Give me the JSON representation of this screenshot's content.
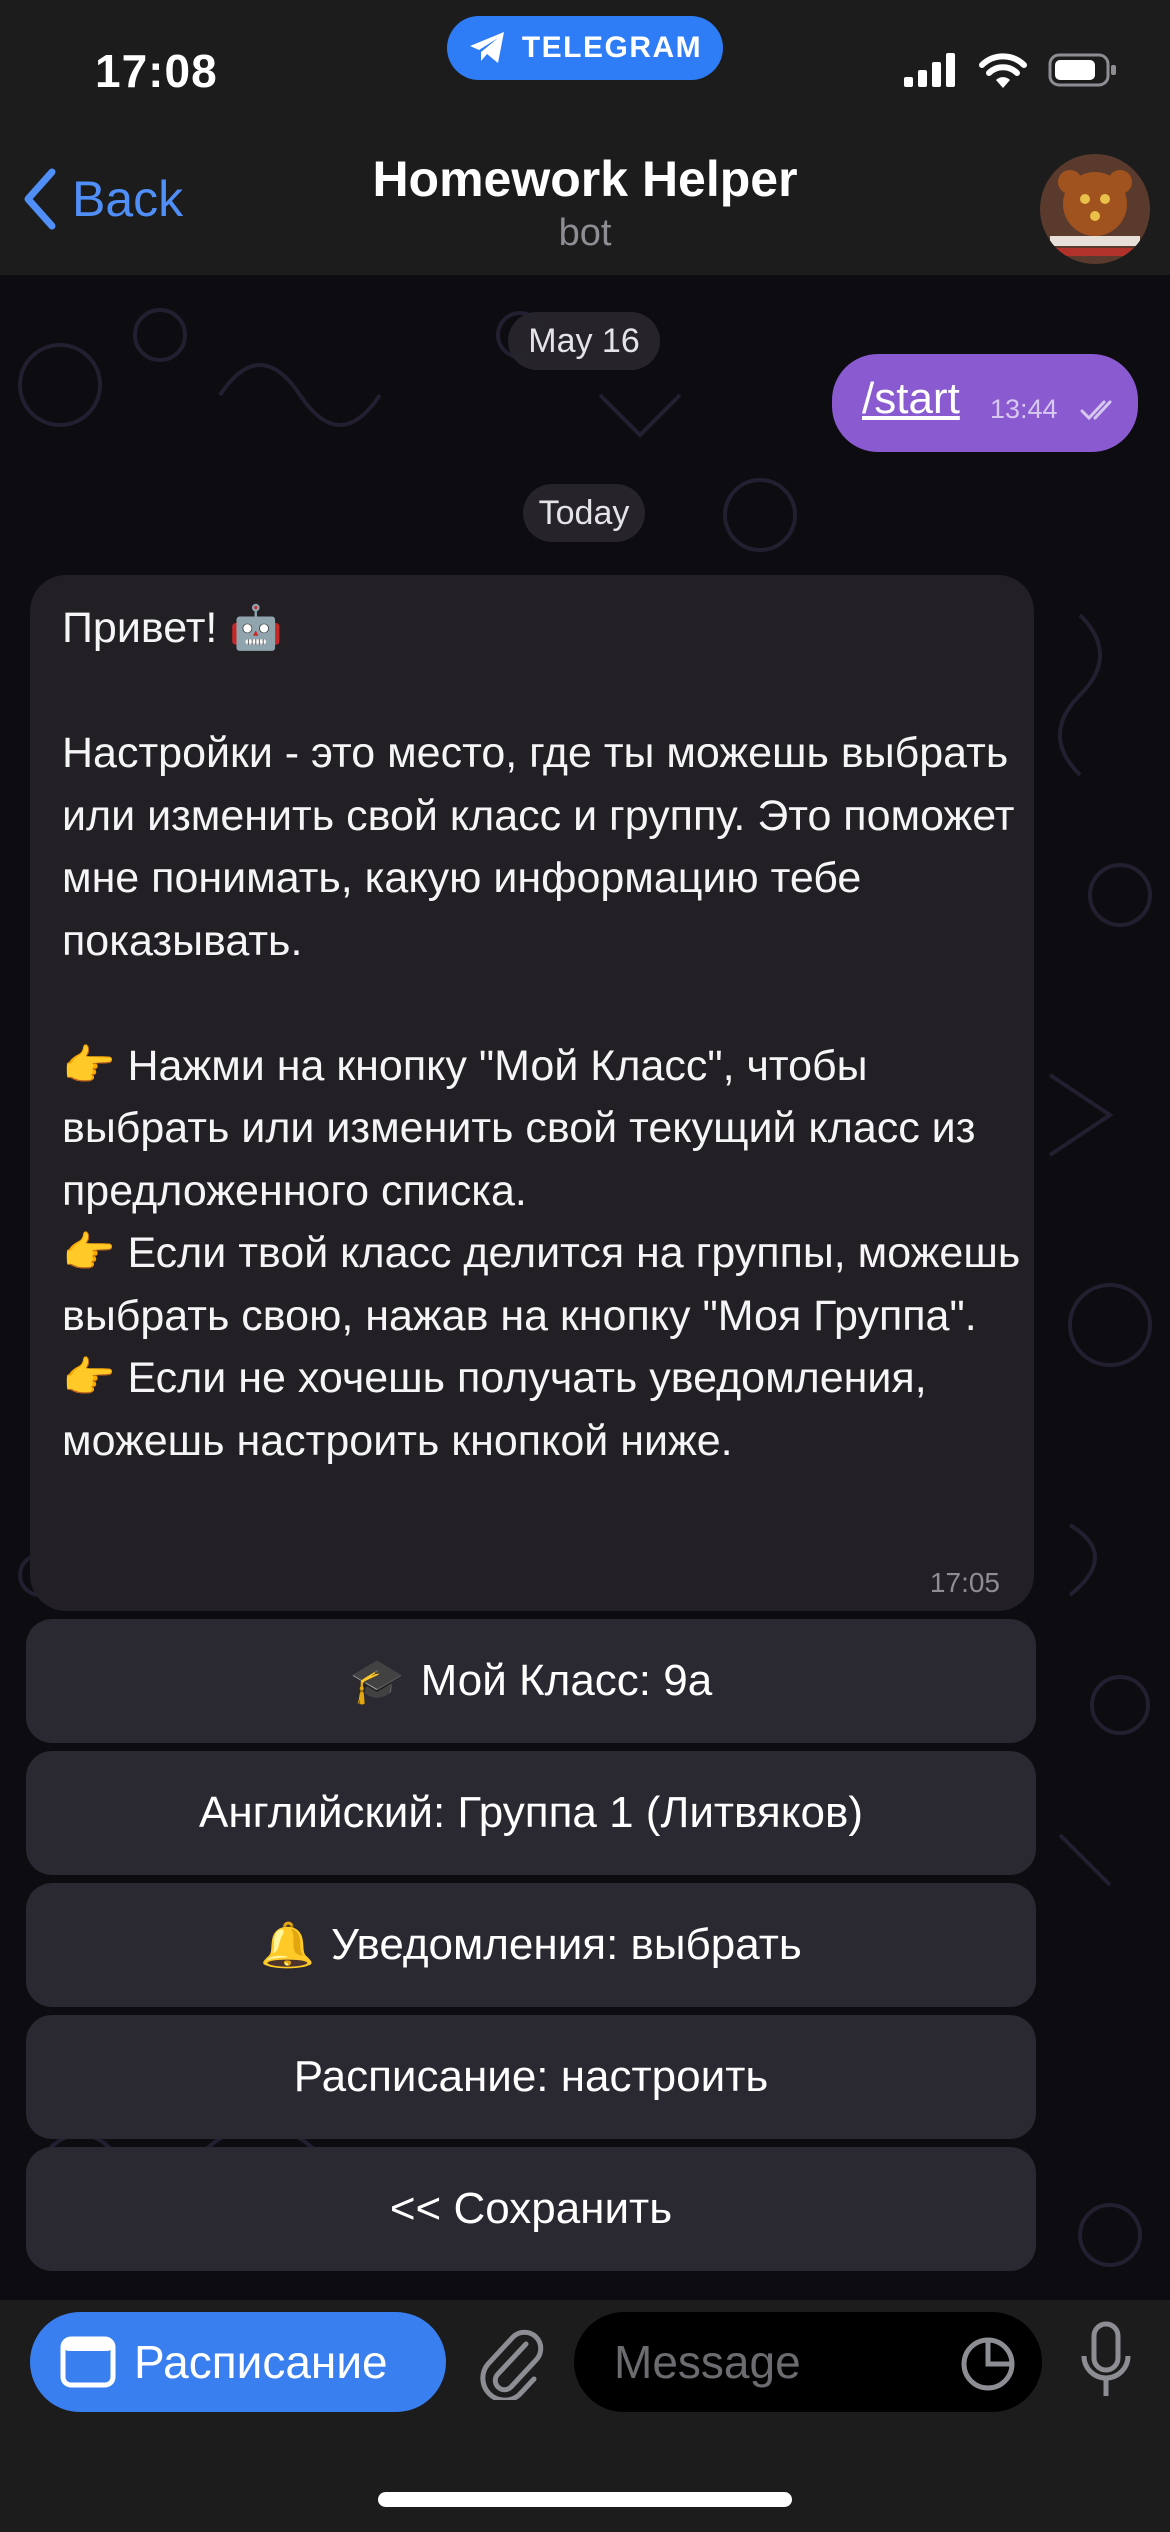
{
  "status_bar": {
    "time": "17:08",
    "source_app": "TELEGRAM"
  },
  "header": {
    "back_label": "Back",
    "title": "Homework Helper",
    "subtitle": "bot"
  },
  "chat": {
    "date_1": "May 16",
    "outgoing": {
      "text": "/start",
      "time": "13:44"
    },
    "date_2": "Today",
    "incoming": {
      "text": "Привет! 🤖\n\nНастройки - это место, где ты можешь выбрать или изменить свой класс и группу. Это поможет мне понимать, какую информацию тебе показывать.\n\n👉 Нажми на кнопку \"Мой Класс\", чтобы выбрать или изменить свой текущий класс из предложенного списка.\n👉 Если твой класс делится на группы, можешь выбрать свою, нажав на кнопку \"Моя Группа\".\n👉 Если не хочешь получать уведомления, можешь настроить кнопкой ниже.",
      "time": "17:05"
    },
    "keyboard": [
      {
        "icon": "🎓",
        "label": "Мой Класс: 9а"
      },
      {
        "icon": "",
        "label": "Английский: Группа 1 (Литвяков)"
      },
      {
        "icon": "🔔",
        "label": "Уведомления: выбрать"
      },
      {
        "icon": "",
        "label": "Расписание: настроить"
      },
      {
        "icon": "",
        "label": "<< Сохранить"
      }
    ]
  },
  "input_bar": {
    "menu_button_label": "Расписание",
    "message_placeholder": "Message"
  },
  "colors": {
    "accent": "#3a7ff0",
    "outgoing_bubble": "#8a5ad0",
    "incoming_bubble": "#221f25",
    "bar_bg": "#1c1c1d"
  }
}
